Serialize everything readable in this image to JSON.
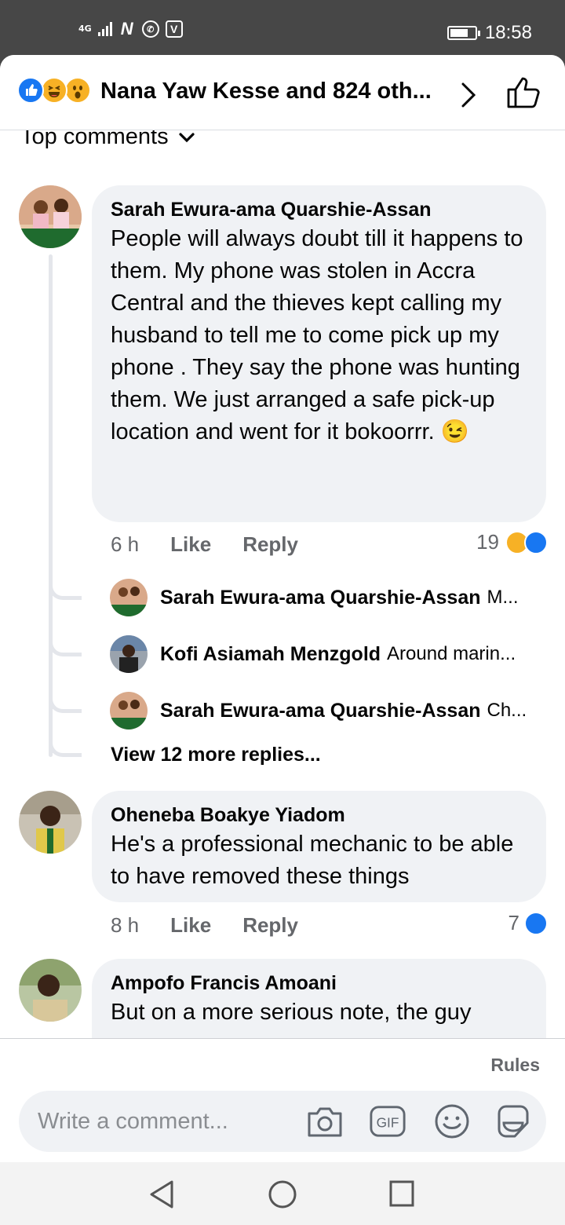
{
  "status_bar": {
    "network": "4G",
    "time": "18:58",
    "battery_level": 0.72,
    "icons": [
      "signal-icon",
      "n-icon",
      "whatsapp-icon",
      "v-app-icon"
    ]
  },
  "header": {
    "reactions": [
      "like",
      "haha",
      "wow"
    ],
    "reaction_summary": "Nana Yaw Kesse and 824 oth...",
    "chevron_icon": "chevron-right-icon",
    "like_icon": "thumbs-up-outline-icon"
  },
  "sort": {
    "label": "Top comments"
  },
  "comments": [
    {
      "author": "Sarah Ewura-ama Quarshie-Assan",
      "text": "People will always doubt till it happens to them.  My phone was stolen in Accra Central and the thieves kept calling my husband to tell me to come pick up my phone . They  say the phone was hunting them.  We just arranged a safe pick-up location and went for it bokoorrr. 😉",
      "time": "6 h",
      "like_label": "Like",
      "reply_label": "Reply",
      "reaction_count": "19",
      "reactions": [
        "haha",
        "like"
      ],
      "replies": [
        {
          "author": "Sarah Ewura-ama Quarshie-Assan",
          "preview": "M..."
        },
        {
          "author": "Kofi Asiamah Menzgold",
          "preview": "Around marin..."
        },
        {
          "author": "Sarah Ewura-ama Quarshie-Assan",
          "preview": "Ch..."
        }
      ],
      "view_more": "View 12 more replies..."
    },
    {
      "author": "Oheneba Boakye Yiadom",
      "text": "He's a professional mechanic to be able to have removed these things",
      "time": "8 h",
      "like_label": "Like",
      "reply_label": "Reply",
      "reaction_count": "7",
      "reactions": [
        "like"
      ]
    },
    {
      "author": "Ampofo Francis Amoani",
      "text": "But on a more serious note, the guy"
    }
  ],
  "composer": {
    "rules_label": "Rules",
    "placeholder": "Write a comment...",
    "icons": [
      "camera-icon",
      "gif-icon",
      "emoji-icon",
      "sticker-icon"
    ]
  },
  "colors": {
    "like_blue": "#1877f2",
    "haha_yellow": "#f7b125",
    "bubble": "#f0f2f5",
    "secondary_text": "#65676b"
  }
}
